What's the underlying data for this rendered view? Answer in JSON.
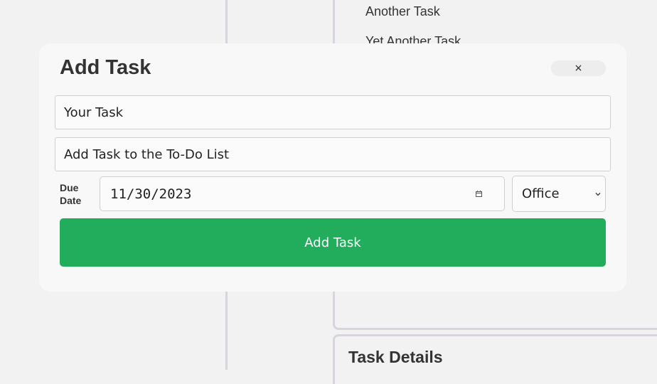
{
  "background": {
    "tasks": [
      "Another Task",
      "Yet Another Task"
    ],
    "details_title": "Task Details"
  },
  "modal": {
    "title": "Add Task",
    "close_label": "×",
    "task_name": {
      "value": "Your Task"
    },
    "task_description": {
      "value": "Add Task to the To-Do List"
    },
    "due_date_label": "Due Date",
    "due_date_value": "11/30/2023",
    "category_value": "Office",
    "submit_label": "Add Task"
  },
  "colors": {
    "submit_button": "#22ad5c",
    "modal_background": "#f8f8f8",
    "page_background": "#f2f2f2",
    "divider": "#d9d3de"
  },
  "icons": [
    "calendar-icon",
    "chevron-down-icon",
    "close-icon"
  ]
}
